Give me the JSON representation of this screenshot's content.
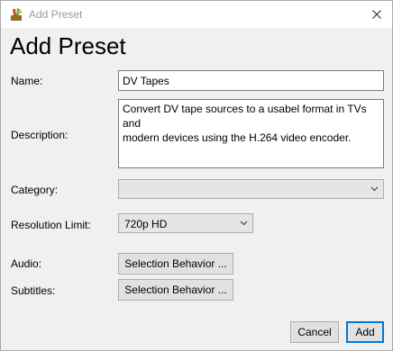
{
  "window": {
    "title": "Add Preset",
    "heading": "Add Preset"
  },
  "form": {
    "name_label": "Name:",
    "name_value": "DV Tapes",
    "description_label": "Description:",
    "description_line1": "Convert DV tape sources to a usabel format in TVs and",
    "description_line2": "modern devices using the H.264 video encoder.",
    "category_label": "Category:",
    "category_value": "",
    "resolution_label": "Resolution Limit:",
    "resolution_value": "720p HD",
    "audio_label": "Audio:",
    "audio_button": "Selection Behavior ...",
    "subtitles_label": "Subtitles:",
    "subtitles_button": "Selection Behavior ..."
  },
  "footer": {
    "cancel_label": "Cancel",
    "add_label": "Add"
  },
  "icons": {
    "app": "handbrake-icon",
    "close": "close-icon",
    "dropdown": "chevron-down-icon"
  },
  "colors": {
    "accent_border": "#0078d7",
    "dialog_bg": "#f0f0f0"
  }
}
